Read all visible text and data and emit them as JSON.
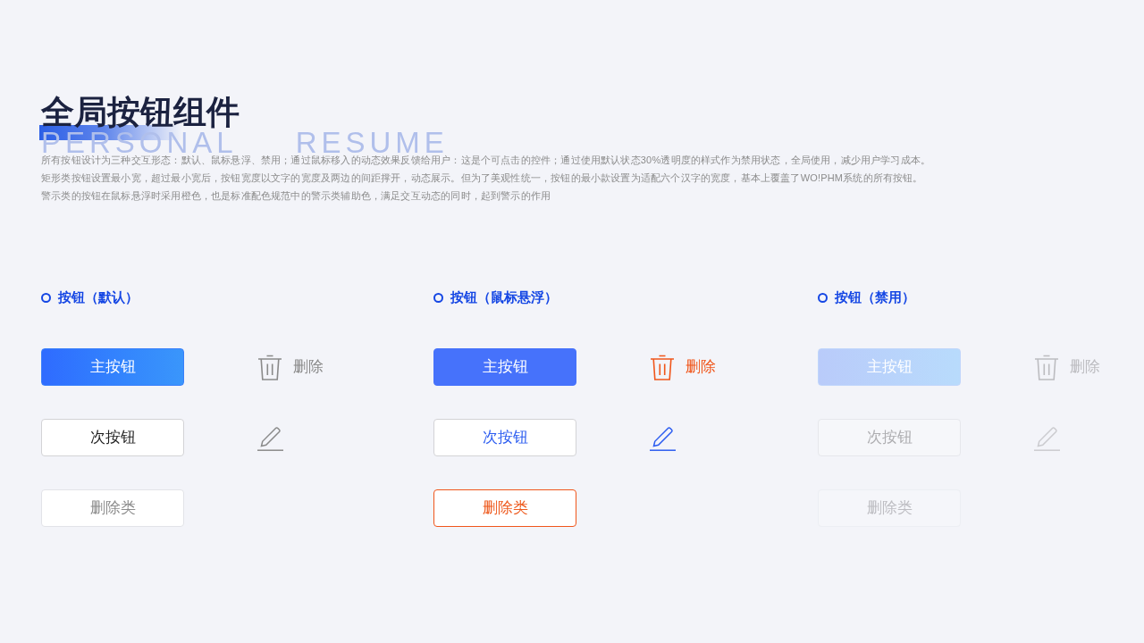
{
  "title": "全局按钮组件",
  "background_text": "PERSONAL RESUME",
  "description": [
    "所有按钮设计为三种交互形态：默认、鼠标悬浮、禁用；通过鼠标移入的动态效果反馈给用户：这是个可点击的控件；通过使用默认状态30%透明度的样式作为禁用状态，全局使用，减少用户学习成本。",
    "矩形类按钮设置最小宽，超过最小宽后，按钮宽度以文字的宽度及两边的间距撑开，动态展示。但为了美观性统一，按钮的最小款设置为适配六个汉字的宽度，基本上覆盖了WO!PHM系统的所有按钮。",
    "警示类的按钮在鼠标悬浮时采用橙色，也是标准配色规范中的警示类辅助色，满足交互动态的同时，起到警示的作用"
  ],
  "sections": [
    {
      "label": "按钮（默认）",
      "hovered": false,
      "disabled": false,
      "primary_button": "主按钮",
      "secondary_button": "次按钮",
      "danger_button": "删除类",
      "delete_button": "删除"
    },
    {
      "label": "按钮（鼠标悬浮）",
      "hovered": true,
      "disabled": false,
      "primary_button": "主按钮",
      "secondary_button": "次按钮",
      "danger_button": "删除类",
      "delete_button": "删除"
    },
    {
      "label": "按钮（禁用）",
      "hovered": false,
      "disabled": true,
      "primary_button": "主按钮",
      "secondary_button": "次按钮",
      "danger_button": "删除类",
      "delete_button": "删除"
    }
  ]
}
